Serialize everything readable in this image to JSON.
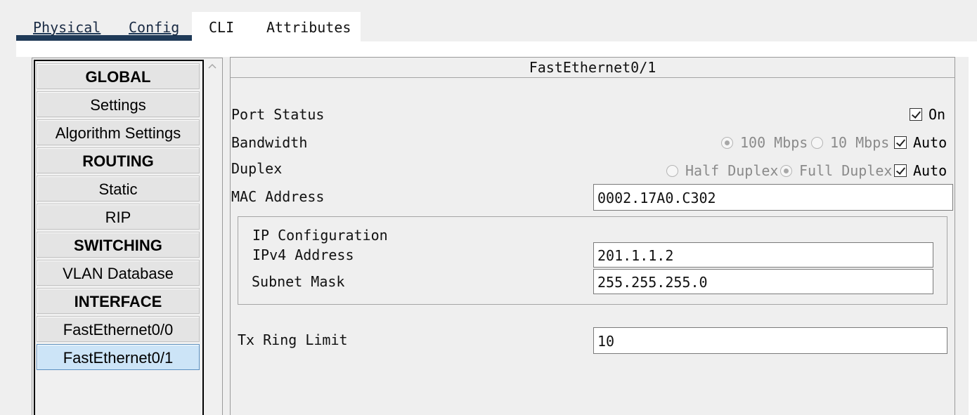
{
  "tabs": [
    {
      "label": "Physical",
      "active": false
    },
    {
      "label": "Config",
      "active": false
    },
    {
      "label": "CLI",
      "active": true
    },
    {
      "label": "Attributes",
      "active": true
    }
  ],
  "nav": {
    "items": [
      {
        "label": "GLOBAL",
        "type": "header"
      },
      {
        "label": "Settings",
        "type": "item"
      },
      {
        "label": "Algorithm Settings",
        "type": "item"
      },
      {
        "label": "ROUTING",
        "type": "header"
      },
      {
        "label": "Static",
        "type": "item"
      },
      {
        "label": "RIP",
        "type": "item"
      },
      {
        "label": "SWITCHING",
        "type": "header"
      },
      {
        "label": "VLAN Database",
        "type": "item"
      },
      {
        "label": "INTERFACE",
        "type": "header"
      },
      {
        "label": "FastEthernet0/0",
        "type": "item"
      },
      {
        "label": "FastEthernet0/1",
        "type": "item",
        "selected": true
      }
    ],
    "scroll_up_icon": "chevron-up-icon"
  },
  "panel": {
    "title": "FastEthernet0/1",
    "port_status": {
      "label": "Port Status",
      "on_label": "On",
      "on_checked": true
    },
    "bandwidth": {
      "label": "Bandwidth",
      "opt_100": "100 Mbps",
      "opt_10": "10 Mbps",
      "auto_label": "Auto",
      "selected": "100 Mbps",
      "auto_checked": true
    },
    "duplex": {
      "label": "Duplex",
      "opt_half": "Half Duplex",
      "opt_full": "Full Duplex",
      "auto_label": "Auto",
      "selected": "Full Duplex",
      "auto_checked": true
    },
    "mac": {
      "label": "MAC Address",
      "value": "0002.17A0.C302"
    },
    "ip_config": {
      "title": "IP Configuration",
      "ipv4_label": "IPv4 Address",
      "ipv4_value": "201.1.1.2",
      "mask_label": "Subnet Mask",
      "mask_value": "255.255.255.0"
    },
    "tx_ring": {
      "label": "Tx Ring Limit",
      "value": "10"
    }
  }
}
